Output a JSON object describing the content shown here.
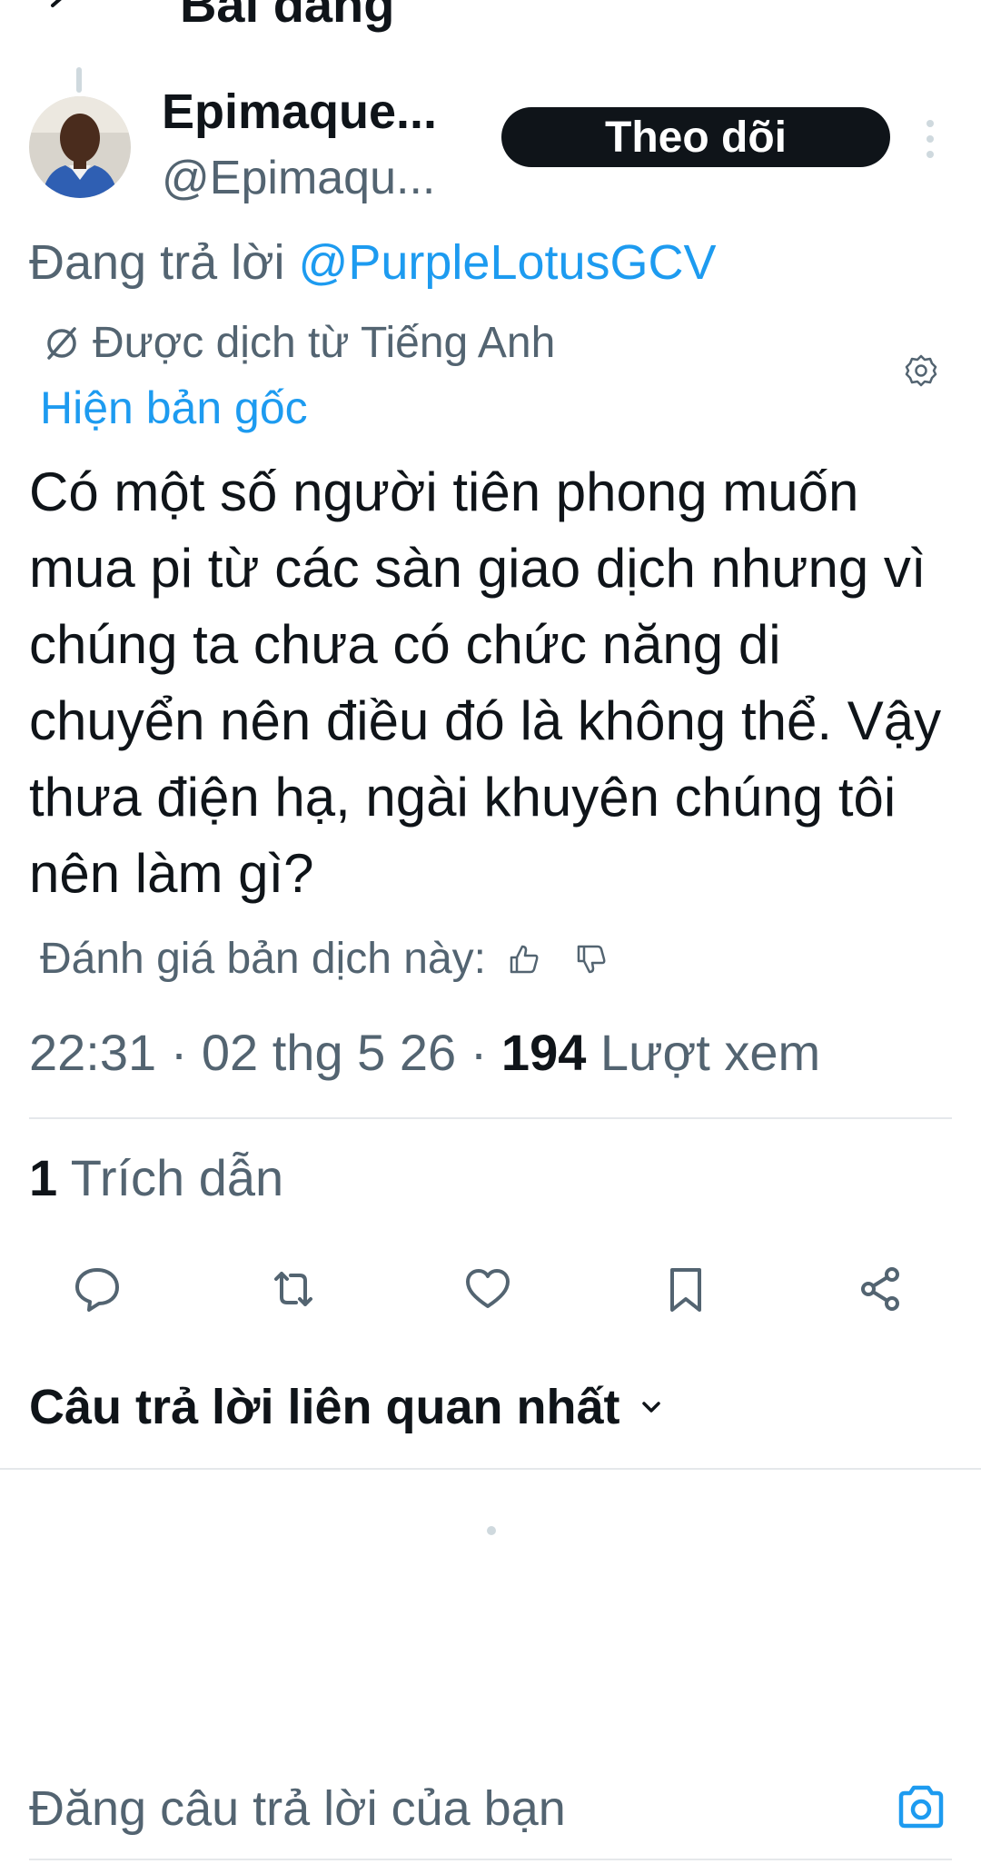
{
  "header": {
    "title": "Bài đăng"
  },
  "author": {
    "display_name": "Epimaque...",
    "handle": "@Epimaqu...",
    "follow_label": "Theo dõi"
  },
  "tweet": {
    "reply_prefix": "Đang trả lời",
    "reply_to": "@PurpleLotusGCV",
    "translated_from": "Được dịch từ Tiếng Anh",
    "show_original": "Hiện bản gốc",
    "text": "Có một số người tiên phong muốn mua pi từ các sàn giao dịch nhưng vì chúng ta chưa có chức năng di chuyển nên điều đó là không thể. Vậy thưa điện hạ, ngài khuyên chúng tôi nên làm gì?",
    "rate_translation": "Đánh giá bản dịch này:",
    "timestamp": "22:31 · 02 thg 5 26 ·",
    "views_count": "194",
    "views_label": "Lượt xem",
    "quote_count": "1",
    "quote_label": "Trích dẫn"
  },
  "replies": {
    "sort_label": "Câu trả lời liên quan nhất"
  },
  "composer": {
    "placeholder": "Đăng câu trả lời của bạn"
  },
  "colors": {
    "link": "#1d9bf0",
    "text": "#0f1419",
    "secondary": "#536471",
    "follow_bg": "#0f1419"
  },
  "icons": {
    "back": "back-arrow-icon",
    "more": "more-vertical-icon",
    "translate": "translate-icon",
    "settings": "gear-icon",
    "reply": "reply-icon",
    "retweet": "retweet-icon",
    "like": "heart-icon",
    "bookmark": "bookmark-icon",
    "share": "share-icon",
    "camera": "camera-icon"
  }
}
